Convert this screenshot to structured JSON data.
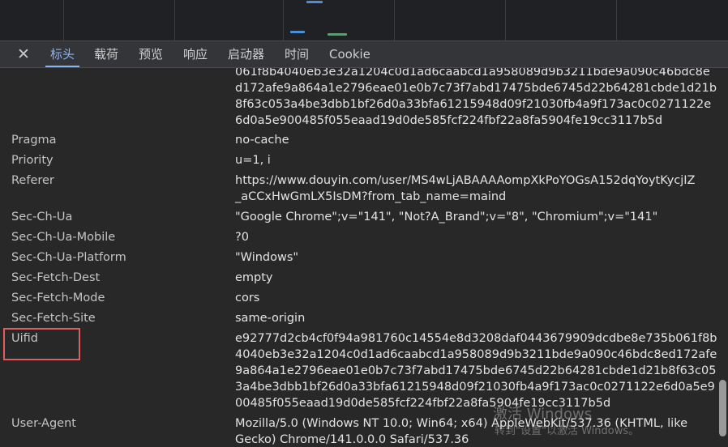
{
  "tabs": {
    "close_symbol": "✕",
    "items": [
      {
        "label": "标头",
        "active": true
      },
      {
        "label": "载荷"
      },
      {
        "label": "预览"
      },
      {
        "label": "响应"
      },
      {
        "label": "启动器"
      },
      {
        "label": "时间"
      },
      {
        "label": "Cookie"
      }
    ]
  },
  "headers": {
    "partial_value_lines": [
      "061f8b4040eb3e32a1204c0d1ad6caabcd1a958089d9b3211bde9a090c46bdc8e",
      "d172afe9a864a1e2796eae01e0b7c73f7abd17475bde6745d22b64281cbde1d21b",
      "8f63c053a4be3dbb1bf26d0a33bfa61215948d09f21030fb4a9f173ac0c0271122e",
      "6d0a5e900485f055eaad19d0de585fcf224fbf22a8fa5904fe19cc3117b5d"
    ],
    "rows": [
      {
        "name": "Pragma",
        "lines": [
          "no-cache"
        ]
      },
      {
        "name": "Priority",
        "lines": [
          "u=1, i"
        ]
      },
      {
        "name": "Referer",
        "lines": [
          "https://www.douyin.com/user/MS4wLjABAAAAompXkPoYOGsA152dqYoytKycjIZ",
          "_aCCxHwGmLX5IsDM?from_tab_name=maind"
        ]
      },
      {
        "name": "Sec-Ch-Ua",
        "lines": [
          "\"Google Chrome\";v=\"141\", \"Not?A_Brand\";v=\"8\", \"Chromium\";v=\"141\""
        ]
      },
      {
        "name": "Sec-Ch-Ua-Mobile",
        "lines": [
          "?0"
        ]
      },
      {
        "name": "Sec-Ch-Ua-Platform",
        "lines": [
          "\"Windows\""
        ]
      },
      {
        "name": "Sec-Fetch-Dest",
        "lines": [
          "empty"
        ]
      },
      {
        "name": "Sec-Fetch-Mode",
        "lines": [
          "cors"
        ]
      },
      {
        "name": "Sec-Fetch-Site",
        "lines": [
          "same-origin"
        ]
      },
      {
        "name": "Uifid",
        "lines": [
          "e92777d2cb4cf0f94a981760c14554e8d3208daf0443679909dcdbe8e735b061f8b",
          "4040eb3e32a1204c0d1ad6caabcd1a958089d9b3211bde9a090c46bdc8ed172afe",
          "9a864a1e2796eae01e0b7c73f7abd17475bde6745d22b64281cbde1d21b8f63c05",
          "3a4be3dbb1bf26d0a33bfa61215948d09f21030fb4a9f173ac0c0271122e6d0a5e9",
          "00485f055eaad19d0de585fcf224fbf22a8fa5904fe19cc3117b5d"
        ],
        "highlighted": true
      },
      {
        "name": "User-Agent",
        "lines": [
          "Mozilla/5.0 (Windows NT 10.0; Win64; x64) AppleWebKit/537.36 (KHTML, like",
          "Gecko) Chrome/141.0.0.0 Safari/537.36"
        ]
      }
    ]
  },
  "watermark": {
    "title": "激活 Windows",
    "subtitle": "转到\"设置\"以激活 Windows。"
  },
  "colors": {
    "background": "#282828",
    "accent": "#8ab4f8",
    "highlight": "#e05d5d"
  }
}
